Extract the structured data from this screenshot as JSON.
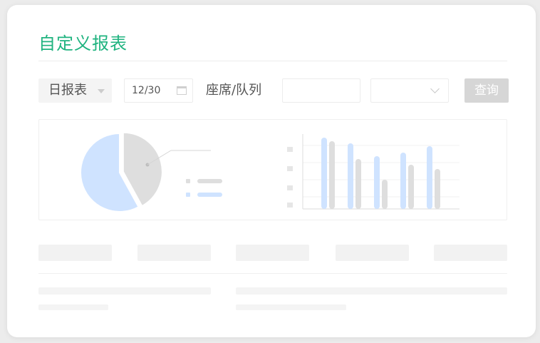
{
  "header": {
    "title": "自定义报表"
  },
  "toolbar": {
    "report_type": "日报表",
    "date_value": "12/30",
    "seat_label": "座席/队列",
    "seat_input_value": "",
    "seat_select_value": "",
    "query_label": "查询"
  },
  "colors": {
    "accent": "#1fb37f",
    "blue": "#cfe3ff",
    "gray": "#dedede",
    "button_disabled": "#d6d6d6"
  },
  "chart_data": [
    {
      "type": "pie",
      "slices": [
        {
          "value": 58,
          "color": "#cfe3ff"
        },
        {
          "value": 42,
          "color": "#dedede"
        }
      ]
    },
    {
      "type": "bar",
      "categories": [
        "",
        "",
        "",
        "",
        ""
      ],
      "series": [
        {
          "values": [
            100,
            92,
            74,
            79,
            88
          ],
          "color": "#cfe3ff"
        },
        {
          "values": [
            95,
            70,
            41,
            62,
            56
          ],
          "color": "#dedede"
        }
      ]
    }
  ]
}
